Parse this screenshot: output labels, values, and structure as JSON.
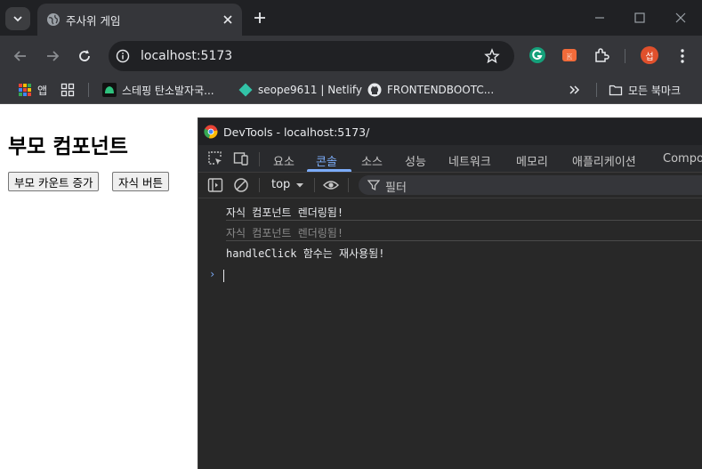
{
  "browser": {
    "tab_title": "주사위 게임",
    "url": "localhost:5173",
    "profile_initial": "섭",
    "bookmarks": [
      {
        "label": "앱"
      },
      {
        "label": "스테핑 탄소발자국..."
      },
      {
        "label": "seope9611 | Netlify"
      },
      {
        "label": "FRONTENDBOOTC..."
      },
      {
        "label": "모든 북마크"
      }
    ]
  },
  "page": {
    "heading": "부모 컴포넌트",
    "parent_button": "부모 카운트 증가",
    "child_button": "자식 버튼"
  },
  "devtools": {
    "window_title": "DevTools - localhost:5173/",
    "tabs": [
      "요소",
      "콘솔",
      "소스",
      "성능",
      "네트워크",
      "메모리",
      "애플리케이션",
      "Compo"
    ],
    "active_tab": "콘솔",
    "context": "top",
    "filter_placeholder": "필터",
    "console_lines": [
      {
        "text": "자식 컴포넌트 렌더링됨!",
        "color": "#e8eaed"
      },
      {
        "text": "자식 컴포넌트 렌더링됨!",
        "color": "#8a8a8a"
      },
      {
        "text": "handleClick 함수는 재사용됨!",
        "color": "#e8eaed"
      }
    ]
  },
  "colors": {
    "accent": "#7cacf8",
    "profile": "#e0502c",
    "titlebar": "#202124",
    "toolbar": "#35363a",
    "console_bg": "#282828"
  },
  "icons": [
    "chevron-down-icon",
    "globe-icon",
    "close-icon",
    "plus-icon",
    "minimize-icon",
    "maximize-icon",
    "back-icon",
    "forward-icon",
    "reload-icon",
    "info-icon",
    "star-icon",
    "grammarly-icon",
    "extension-icon",
    "puzzle-icon",
    "more-icon",
    "apps-grid-icon",
    "folder-icon",
    "inspect-icon",
    "device-icon",
    "sidebar-icon",
    "clear-icon",
    "eye-icon",
    "filter-icon"
  ]
}
